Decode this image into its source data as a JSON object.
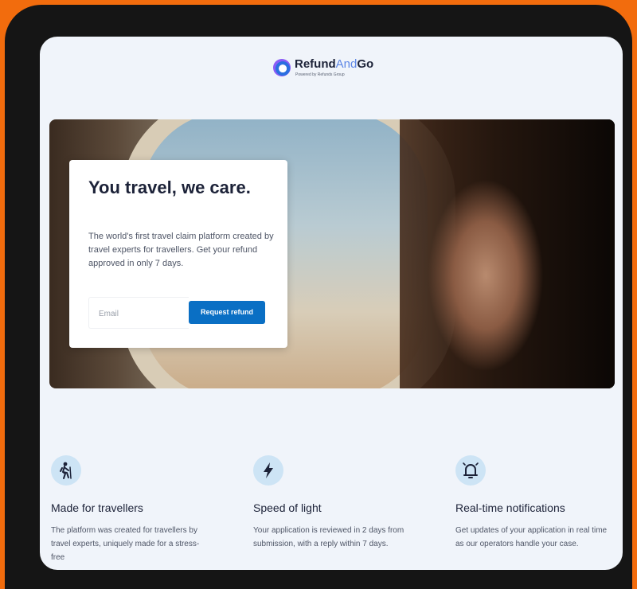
{
  "brand": {
    "name_part1": "Refund",
    "name_part2": "And",
    "name_part3": "Go",
    "tagline": "Powered by Refunds Group"
  },
  "hero": {
    "title": "You travel, we care.",
    "description": "The world's first travel claim platform created by travel experts for travellers. Get your refund approved in only 7 days.",
    "email_placeholder": "Email",
    "cta_label": "Request refund"
  },
  "features": [
    {
      "icon": "hiker-icon",
      "title": "Made for travellers",
      "description": "The platform was created for travellers by travel experts, uniquely made for a stress-free"
    },
    {
      "icon": "lightning-icon",
      "title": "Speed of light",
      "description": "Your application is reviewed in 2 days from submission, with a reply within 7 days."
    },
    {
      "icon": "bell-icon",
      "title": "Real-time notifications",
      "description": "Get updates of your application in real time as our operators handle your case."
    }
  ],
  "colors": {
    "background": "#f26c0d",
    "accent": "#0a6fc4",
    "text": "#1c2238"
  }
}
